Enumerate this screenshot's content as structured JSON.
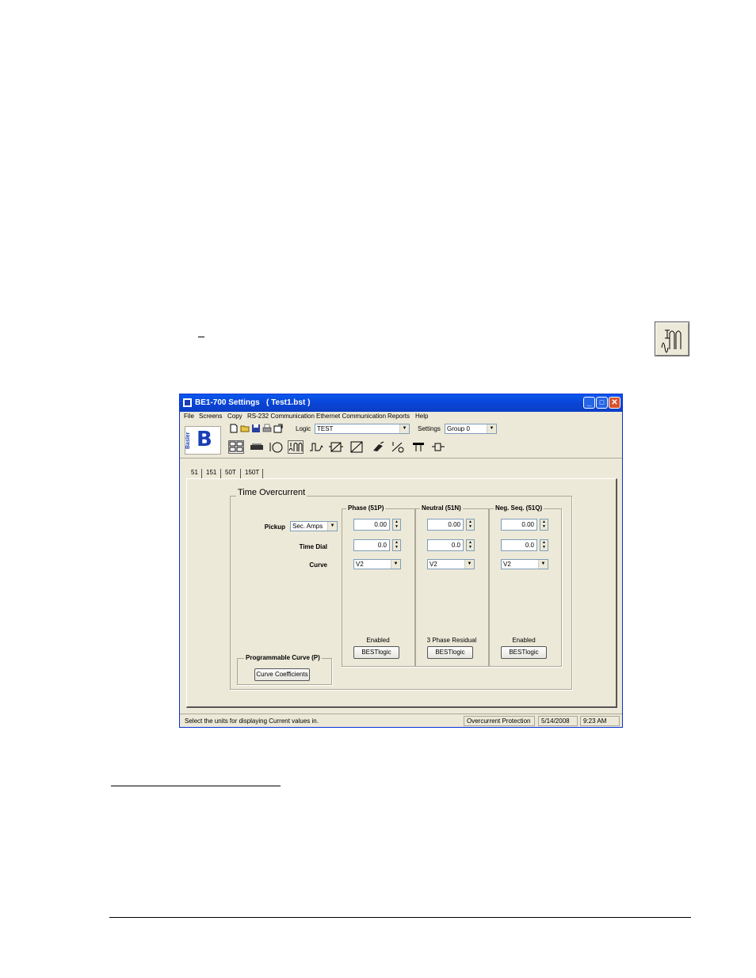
{
  "window": {
    "title": "BE1-700 Settings   ( Test1.bst )",
    "minimize": "_",
    "maximize": "□",
    "close": "✕"
  },
  "menu": [
    "File",
    "Screens",
    "Copy",
    "RS-232 Communication",
    "Ethernet Communication",
    "Reports",
    "Help"
  ],
  "toolbar": {
    "logo_text": "Basler",
    "logo_letter": "B",
    "logic_label": "Logic",
    "logic_value": "TEST",
    "settings_label": "Settings",
    "settings_value": "Group 0"
  },
  "tabs": [
    "51",
    "151",
    "50T",
    "150T"
  ],
  "panel": {
    "group_title": "Time Overcurrent",
    "row_labels": {
      "pickup": "Pickup",
      "time_dial": "Time Dial",
      "curve": "Curve"
    },
    "pickup_units": "Sec. Amps",
    "columns": [
      {
        "title": "Phase (51P)",
        "pickup": "0.00",
        "time_dial": "0.0",
        "curve": "V2",
        "status": "Enabled",
        "button": "BESTlogic"
      },
      {
        "title": "Neutral (51N)",
        "pickup": "0.00",
        "time_dial": "0.0",
        "curve": "V2",
        "status": "3 Phase Residual",
        "button": "BESTlogic"
      },
      {
        "title": "Neg. Seq. (51Q)",
        "pickup": "0.00",
        "time_dial": "0.0",
        "curve": "V2",
        "status": "Enabled",
        "button": "BESTlogic"
      }
    ],
    "programmable": {
      "title": "Programmable Curve (P)",
      "button": "Curve Coefficients"
    }
  },
  "statusbar": {
    "hint": "Select the units for displaying Current values in.",
    "screen": "Overcurrent Protection",
    "date": "5/14/2008",
    "time": "9:23 AM"
  },
  "icons": [
    "new-file-icon",
    "open-folder-icon",
    "save-icon",
    "print-icon",
    "properties-icon",
    "time-overcurrent-icon"
  ]
}
